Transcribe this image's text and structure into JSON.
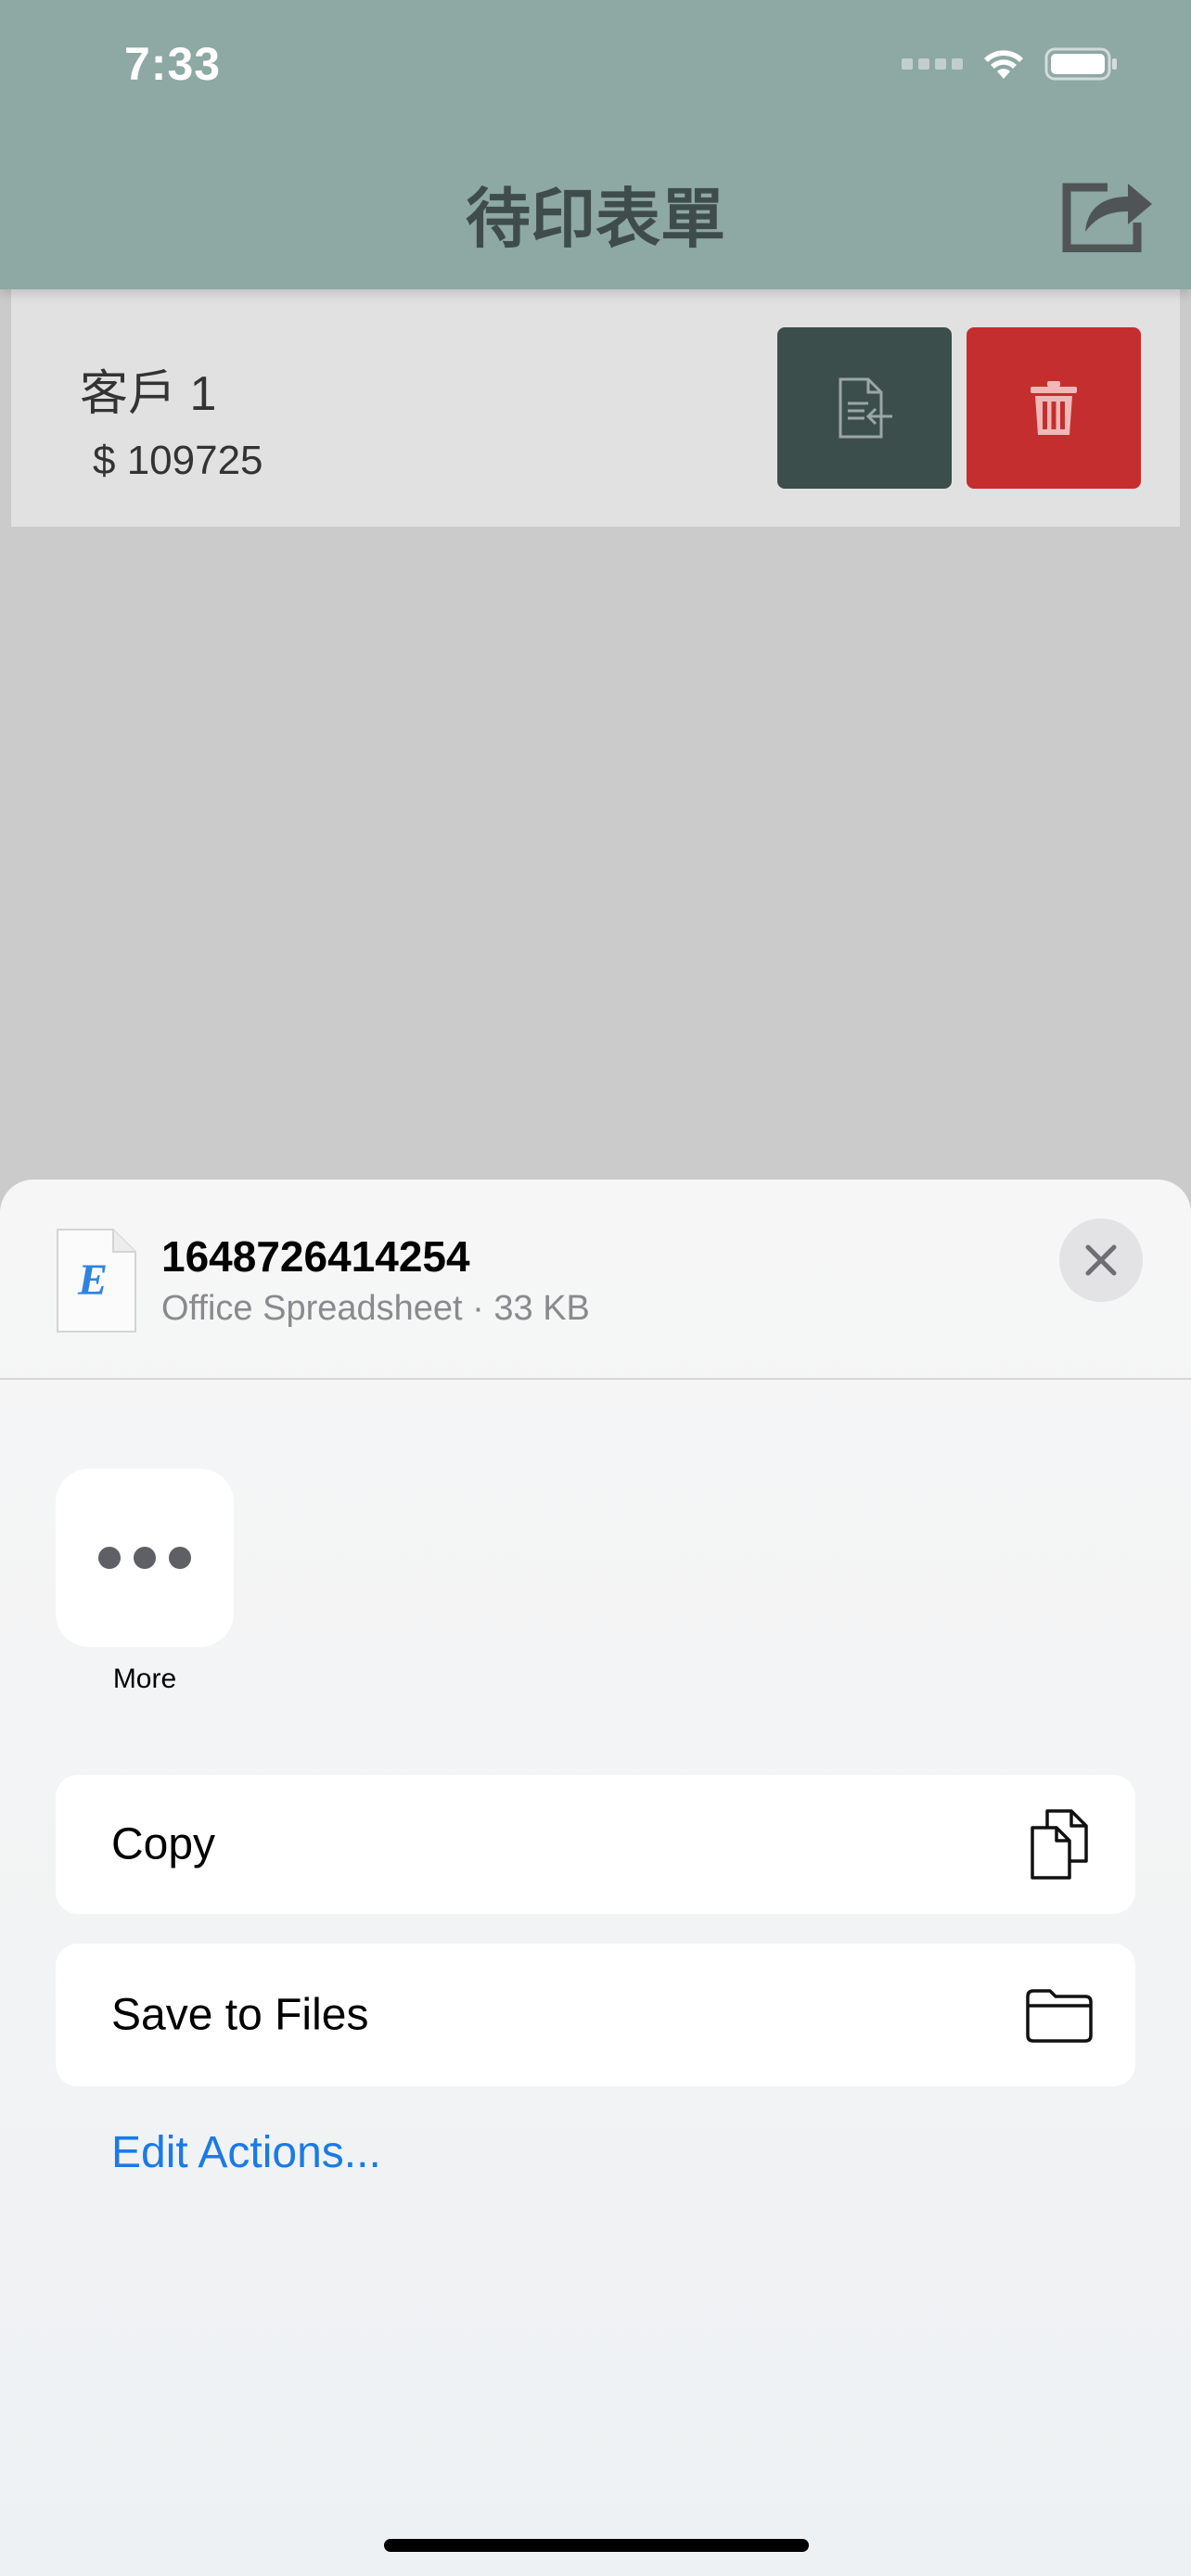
{
  "status_bar": {
    "time": "7:33"
  },
  "nav": {
    "title": "待印表單",
    "share_icon": "share-icon"
  },
  "list": {
    "rows": [
      {
        "name": "客戶 1",
        "amount": "$ 109725"
      }
    ]
  },
  "share_sheet": {
    "file_name": "1648726414254",
    "file_meta": "Office Spreadsheet · 33 KB",
    "file_icon_letter": "E",
    "more_label": "More",
    "actions": [
      {
        "label": "Copy",
        "icon": "copy-icon"
      },
      {
        "label": "Save to Files",
        "icon": "folder-icon"
      }
    ],
    "edit_actions": "Edit Actions..."
  },
  "colors": {
    "nav_bar": "#8ea8a3",
    "doc_button": "#3c4e4b",
    "delete_button": "#c52e2e",
    "link": "#1a7ae6"
  }
}
